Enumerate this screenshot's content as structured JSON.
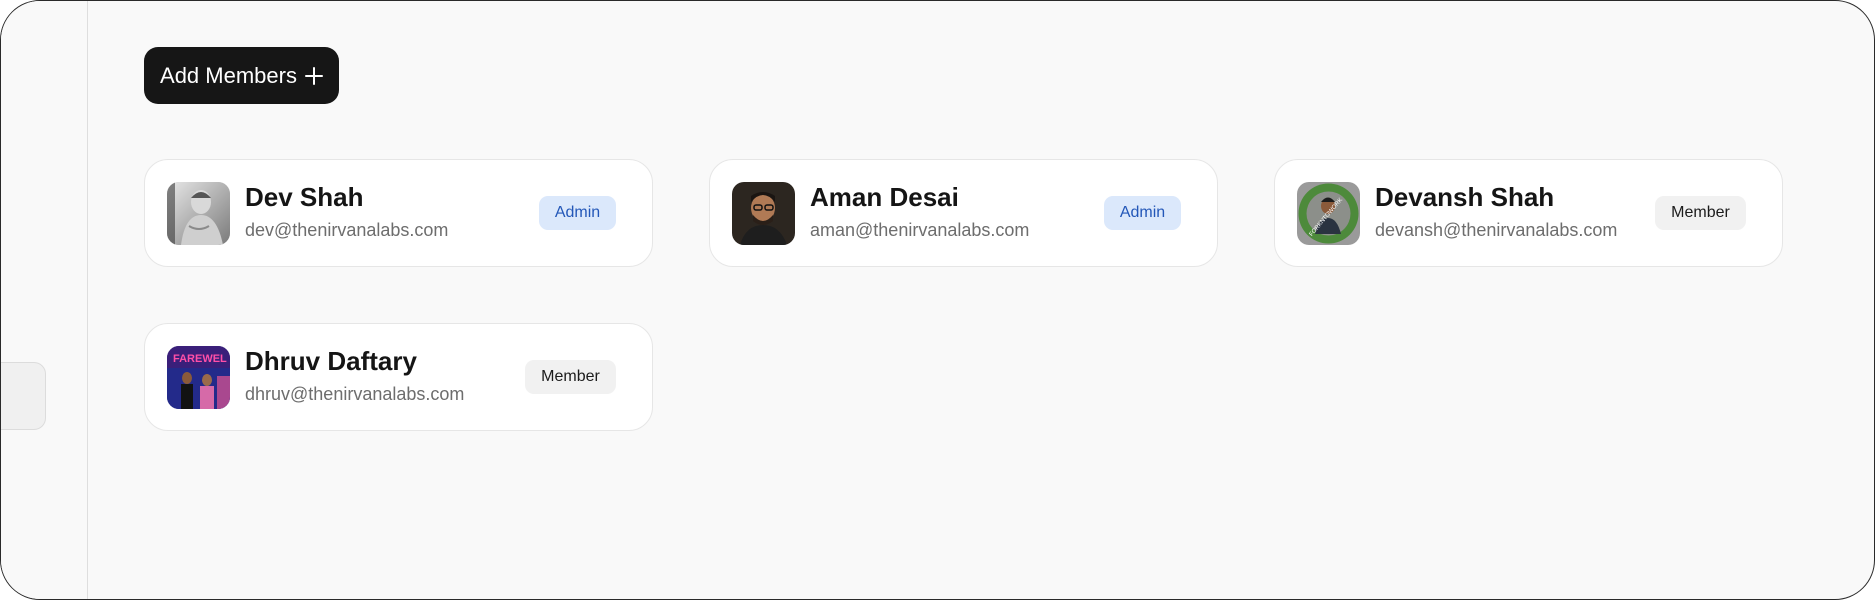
{
  "toolbar": {
    "add_members_label": "Add Members"
  },
  "members": [
    {
      "name": "Dev Shah",
      "email": "dev@thenirvanalabs.com",
      "role": "Admin"
    },
    {
      "name": "Aman Desai",
      "email": "aman@thenirvanalabs.com",
      "role": "Admin"
    },
    {
      "name": "Devansh Shah",
      "email": "devansh@thenirvanalabs.com",
      "role": "Member"
    },
    {
      "name": "Dhruv Daftary",
      "email": "dhruv@thenirvanalabs.com",
      "role": "Member"
    }
  ],
  "avatar_badge_text": "FORKNTOWORK",
  "avatar_banner_text": "FAREWEL",
  "colors": {
    "add_button_bg": "#161616",
    "admin_badge_bg": "#dbe8fb",
    "admin_badge_text": "#2357b8",
    "member_badge_bg": "#f1f1f1",
    "page_bg": "#f9f9f9"
  }
}
